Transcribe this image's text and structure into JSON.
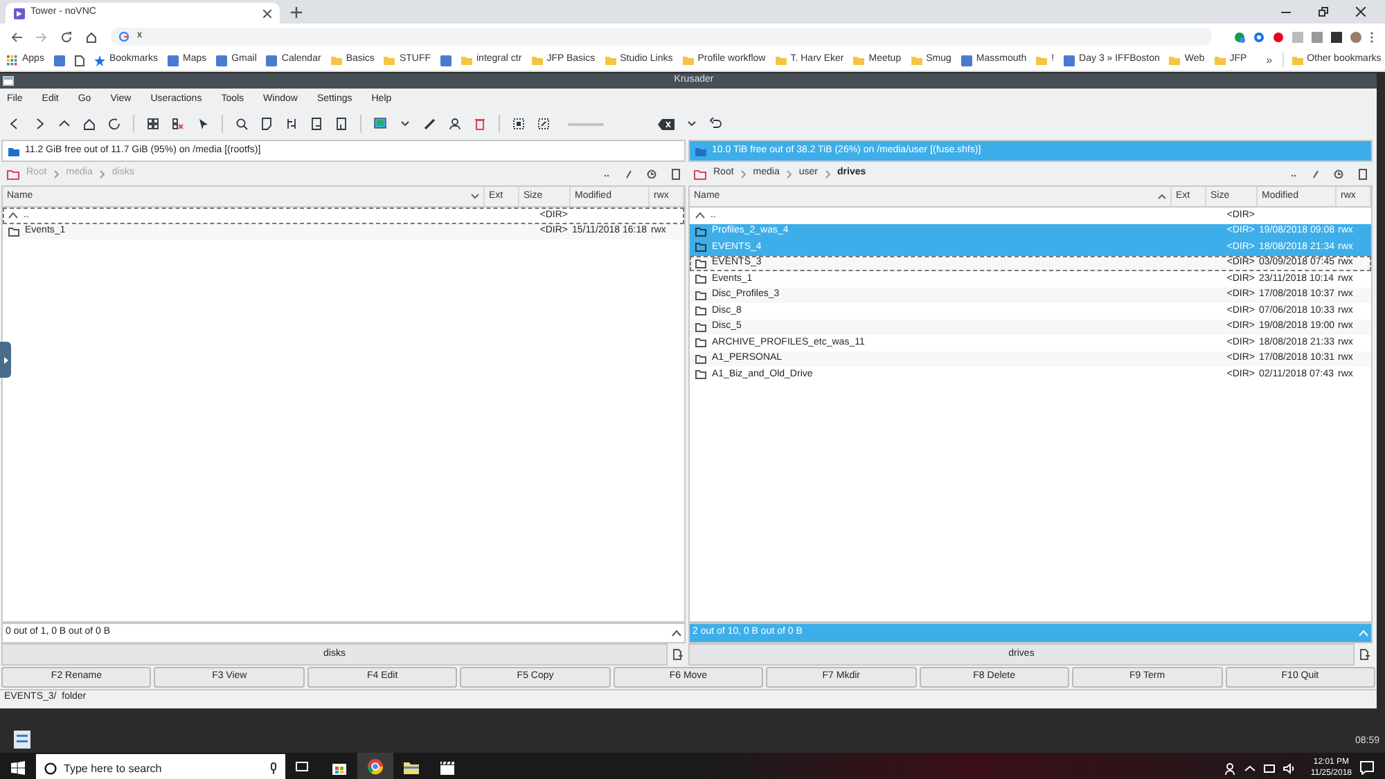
{
  "browser": {
    "tabs": [
      {
        "title": "Tower - noVNC",
        "selected": true
      }
    ],
    "address": "x",
    "bookmarks": [
      {
        "kind": "apps",
        "label": "Apps"
      },
      {
        "kind": "site"
      },
      {
        "kind": "page"
      },
      {
        "kind": "star",
        "label": "Bookmarks"
      },
      {
        "kind": "site",
        "label": "Maps"
      },
      {
        "kind": "site",
        "label": "Gmail"
      },
      {
        "kind": "site",
        "label": "Calendar"
      },
      {
        "kind": "folder",
        "label": "Basics"
      },
      {
        "kind": "folder",
        "label": "STUFF"
      },
      {
        "kind": "site"
      },
      {
        "kind": "folder",
        "label": "integral ctr"
      },
      {
        "kind": "folder",
        "label": "JFP Basics"
      },
      {
        "kind": "folder",
        "label": "Studio Links"
      },
      {
        "kind": "folder",
        "label": "Profile workflow"
      },
      {
        "kind": "folder",
        "label": "T. Harv Eker"
      },
      {
        "kind": "folder",
        "label": "Meetup"
      },
      {
        "kind": "folder",
        "label": "Smug"
      },
      {
        "kind": "site",
        "label": "Massmouth"
      },
      {
        "kind": "folder",
        "label": "!"
      },
      {
        "kind": "site",
        "label": "Day 3 » IFFBoston"
      },
      {
        "kind": "folder",
        "label": "Web"
      },
      {
        "kind": "folder",
        "label": "JFP"
      }
    ],
    "overflow": "»",
    "other_bookmarks": "Other bookmarks"
  },
  "window": {
    "title": "Krusader"
  },
  "menu": [
    "File",
    "Edit",
    "Go",
    "View",
    "Useractions",
    "Tools",
    "Window",
    "Settings",
    "Help"
  ],
  "panels": [
    {
      "active": false,
      "free_space": "11.2 GiB free out of 11.7 GiB (95%) on /media [(rootfs)]",
      "path": [
        "Root",
        "media",
        "disks"
      ],
      "columns": [
        "Name",
        "Ext",
        "Size",
        "Modified",
        "rwx"
      ],
      "rows": [
        {
          "kind": "up",
          "name": "..",
          "size": "<DIR>",
          "selected": false,
          "current": true
        },
        {
          "kind": "dir",
          "name": "Events_1",
          "size": "<DIR>",
          "modified": "15/11/2018 16:18",
          "rwx": "rwx",
          "selected": false,
          "current": false
        }
      ],
      "totals": "0 out of 1, 0 B out of 0 B",
      "label": "disks"
    },
    {
      "active": true,
      "free_space": "10.0 TiB free out of 38.2 TiB (26%) on /media/user [(fuse.shfs)]",
      "path": [
        "Root",
        "media",
        "user",
        "drives"
      ],
      "columns": [
        "Name",
        "Ext",
        "Size",
        "Modified",
        "rwx"
      ],
      "rows": [
        {
          "kind": "up",
          "name": "..",
          "size": "<DIR>",
          "selected": false,
          "current": false
        },
        {
          "kind": "dir",
          "name": "Profiles_2_was_4",
          "size": "<DIR>",
          "modified": "19/08/2018 09:08",
          "rwx": "rwx",
          "selected": true,
          "current": false
        },
        {
          "kind": "dir",
          "name": "EVENTS_4",
          "size": "<DIR>",
          "modified": "18/08/2018 21:34",
          "rwx": "rwx",
          "selected": true,
          "current": false
        },
        {
          "kind": "dir",
          "name": "EVENTS_3",
          "size": "<DIR>",
          "modified": "03/09/2018 07:45",
          "rwx": "rwx",
          "selected": false,
          "current": true
        },
        {
          "kind": "dir",
          "name": "Events_1",
          "size": "<DIR>",
          "modified": "23/11/2018 10:14",
          "rwx": "rwx",
          "selected": false,
          "current": false
        },
        {
          "kind": "dir",
          "name": "Disc_Profiles_3",
          "size": "<DIR>",
          "modified": "17/08/2018 10:37",
          "rwx": "rwx",
          "selected": false,
          "current": false
        },
        {
          "kind": "dir",
          "name": "Disc_8",
          "size": "<DIR>",
          "modified": "07/06/2018 10:33",
          "rwx": "rwx",
          "selected": false,
          "current": false
        },
        {
          "kind": "dir",
          "name": "Disc_5",
          "size": "<DIR>",
          "modified": "19/08/2018 19:00",
          "rwx": "rwx",
          "selected": false,
          "current": false
        },
        {
          "kind": "dir",
          "name": "ARCHIVE_PROFILES_etc_was_11",
          "size": "<DIR>",
          "modified": "18/08/2018 21:33",
          "rwx": "rwx",
          "selected": false,
          "current": false
        },
        {
          "kind": "dir",
          "name": "A1_PERSONAL",
          "size": "<DIR>",
          "modified": "17/08/2018 10:31",
          "rwx": "rwx",
          "selected": false,
          "current": false
        },
        {
          "kind": "dir",
          "name": "A1_Biz_and_Old_Drive",
          "size": "<DIR>",
          "modified": "02/11/2018 07:43",
          "rwx": "rwx",
          "selected": false,
          "current": false
        }
      ],
      "totals": "2 out of 10, 0 B out of 0 B",
      "label": "drives"
    }
  ],
  "function_keys": [
    "F2 Rename",
    "F3 View",
    "F4 Edit",
    "F5 Copy",
    "F6 Move",
    "F7 Mkdir",
    "F8 Delete",
    "F9 Term",
    "F10 Quit"
  ],
  "status": "EVENTS_3/  folder",
  "vnc_clock": "08:59",
  "taskbar": {
    "search_placeholder": "Type here to search",
    "time": "12:01 PM",
    "date": "11/25/2018"
  }
}
